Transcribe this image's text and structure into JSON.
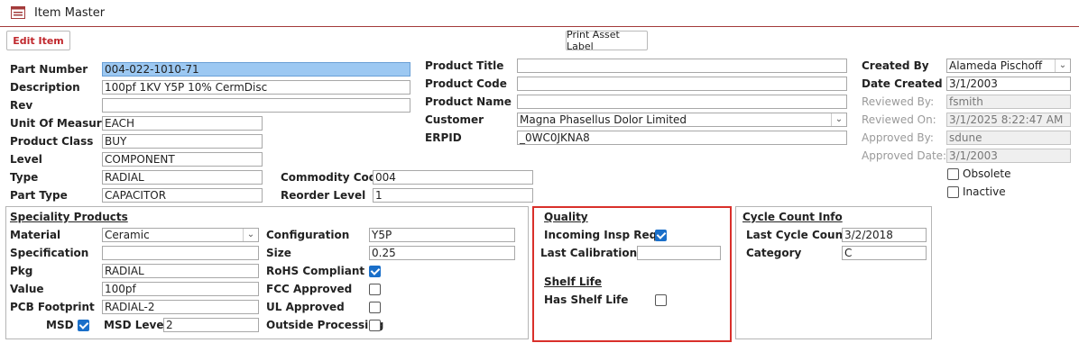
{
  "window": {
    "title": "Item Master"
  },
  "toolbar": {
    "edit_item": "Edit Item",
    "print_asset_label": "Print Asset Label"
  },
  "col1": {
    "part_number": {
      "label": "Part Number",
      "value": "004-022-1010-71"
    },
    "description": {
      "label": "Description",
      "value": "100pf 1KV Y5P 10% CermDisc"
    },
    "rev": {
      "label": "Rev",
      "value": ""
    },
    "unit_of_measure": {
      "label": "Unit Of Measure",
      "value": "EACH"
    },
    "product_class": {
      "label": "Product Class",
      "value": "BUY"
    },
    "level": {
      "label": "Level",
      "value": "COMPONENT"
    },
    "type": {
      "label": "Type",
      "value": "RADIAL"
    },
    "part_type": {
      "label": "Part Type",
      "value": "CAPACITOR"
    }
  },
  "col1b": {
    "commodity_code": {
      "label": "Commodity Code",
      "value": "004"
    },
    "reorder_level": {
      "label": "Reorder Level",
      "value": "1"
    }
  },
  "col2": {
    "product_title": {
      "label": "Product Title",
      "value": ""
    },
    "product_code": {
      "label": "Product Code",
      "value": ""
    },
    "product_name": {
      "label": "Product Name",
      "value": ""
    },
    "customer": {
      "label": "Customer",
      "value": "Magna Phasellus Dolor Limited"
    },
    "erpid": {
      "label": "ERPID",
      "value": "_0WC0JKNA8"
    }
  },
  "col3": {
    "created_by": {
      "label": "Created By",
      "value": "Alameda Pischoff"
    },
    "date_created": {
      "label": "Date Created",
      "value": "3/1/2003"
    },
    "reviewed_by": {
      "label": "Reviewed By:",
      "value": "fsmith"
    },
    "reviewed_on": {
      "label": "Reviewed On:",
      "value": "3/1/2025 8:22:47 AM"
    },
    "approved_by": {
      "label": "Approved By:",
      "value": "sdune"
    },
    "approved_date": {
      "label": "Approved Date:",
      "value": "3/1/2003"
    },
    "obsolete": {
      "label": "Obsolete",
      "checked": false
    },
    "inactive": {
      "label": "Inactive",
      "checked": false
    }
  },
  "speciality": {
    "title": "Speciality Products",
    "material": {
      "label": "Material",
      "value": "Ceramic"
    },
    "specification": {
      "label": "Specification",
      "value": ""
    },
    "pkg": {
      "label": "Pkg",
      "value": "RADIAL"
    },
    "value": {
      "label": "Value",
      "value": "100pf"
    },
    "pcb_footprint": {
      "label": "PCB Footprint",
      "value": "RADIAL-2"
    },
    "msd": {
      "label": "MSD",
      "checked": true
    },
    "msd_level": {
      "label": "MSD Level",
      "value": "2"
    },
    "configuration": {
      "label": "Configuration",
      "value": "Y5P"
    },
    "size": {
      "label": "Size",
      "value": "0.25"
    },
    "rohs": {
      "label": "RoHS Compliant",
      "checked": true
    },
    "fcc": {
      "label": "FCC Approved",
      "checked": false
    },
    "ul": {
      "label": "UL Approved",
      "checked": false
    },
    "outside_processing": {
      "label": "Outside Processing",
      "checked": false
    }
  },
  "quality": {
    "title": "Quality",
    "incoming_insp": {
      "label": "Incoming Insp Reqd",
      "checked": true
    },
    "last_calibration": {
      "label": "Last Calibration",
      "value": ""
    },
    "shelf_life_title": "Shelf Life",
    "has_shelf_life": {
      "label": "Has Shelf Life",
      "checked": false
    }
  },
  "cycle_count": {
    "title": "Cycle Count Info",
    "last_cycle_count": {
      "label": "Last Cycle Count",
      "value": "3/2/2018"
    },
    "category": {
      "label": "Category",
      "value": "C"
    }
  },
  "colors": {
    "accent_line": "#a33a3a",
    "highlight_box": "#d9302b",
    "check_blue": "#1a6fc9",
    "selected_field": "#9cc8f2"
  }
}
